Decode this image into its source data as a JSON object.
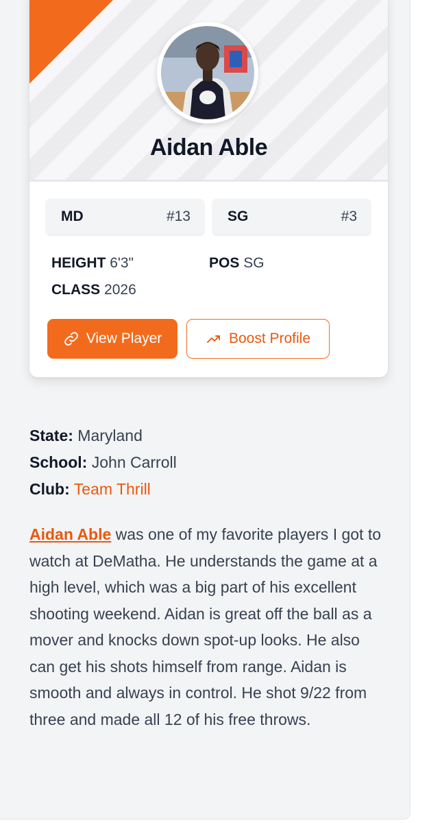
{
  "player": {
    "name": "Aidan Able",
    "state_chip": "MD",
    "state_rank": "#13",
    "position_chip": "SG",
    "position_rank": "#3",
    "height_label": "HEIGHT",
    "height_value": "6'3\"",
    "pos_label": "POS",
    "pos_value": "SG",
    "class_label": "CLASS",
    "class_value": "2026"
  },
  "buttons": {
    "view_label": "View Player",
    "boost_label": "Boost Profile"
  },
  "info": {
    "state_label": "State:",
    "state_value": "Maryland",
    "school_label": "School:",
    "school_value": "John Carroll",
    "club_label": "Club:",
    "club_value": "Team Thrill"
  },
  "bio": {
    "link_text": "Aidan Able",
    "text": " was one of my favorite players I got to watch at DeMatha. He understands the game at a high level, which was a big part of his excellent shooting weekend. Aidan is great off the ball as a mover and knocks down spot-up looks. He also can get his shots himself from range. Aidan is smooth and always in control. He shot 9/22 from three and made all 12 of his free throws."
  },
  "colors": {
    "accent": "#f26b1d",
    "panel_bg": "#f3f4f6",
    "text_dark": "#111827",
    "text_gray": "#374151"
  },
  "icons": {
    "view_button_icon": "link-icon",
    "boost_button_icon": "trending-up-icon"
  }
}
